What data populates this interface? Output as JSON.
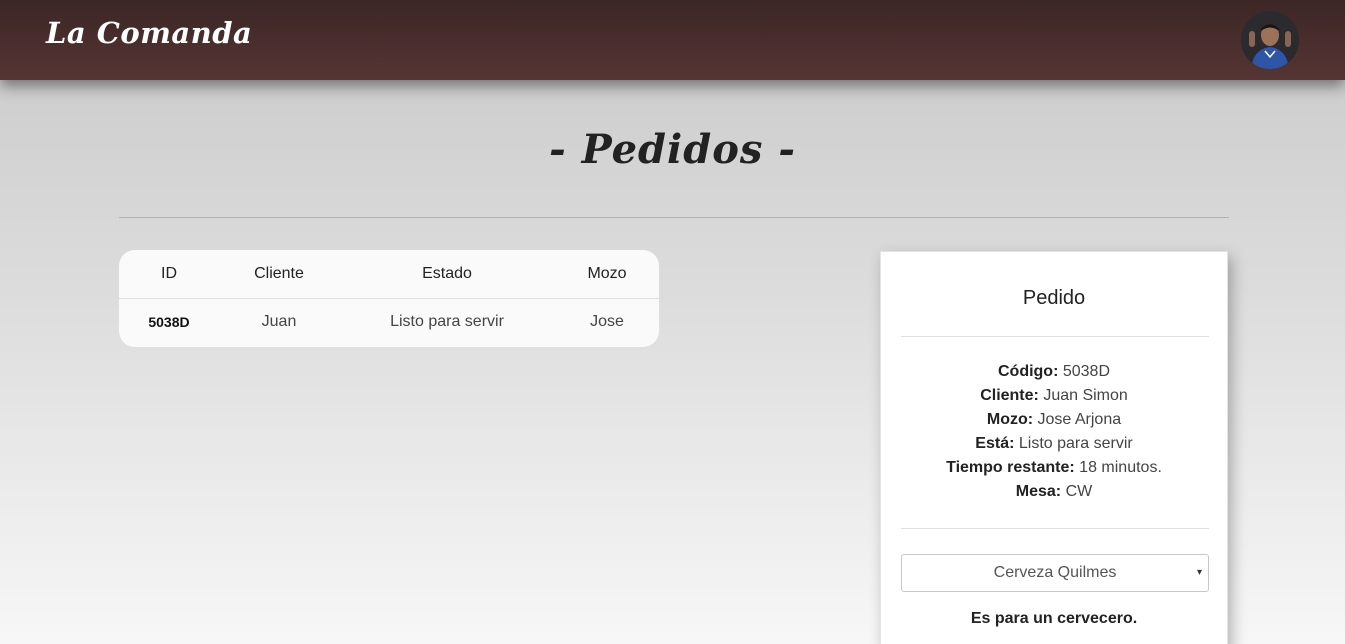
{
  "navbar": {
    "brand": "La Comanda",
    "avatar_icon": "user-avatar-photo"
  },
  "page": {
    "title": "- Pedidos -"
  },
  "orders_table": {
    "headers": [
      "ID",
      "Cliente",
      "Estado",
      "Mozo"
    ],
    "rows": [
      {
        "id": "5038D",
        "cliente": "Juan",
        "estado": "Listo para servir",
        "mozo": "Jose"
      }
    ]
  },
  "order_card": {
    "title": "Pedido",
    "fields": [
      {
        "label": "Código:",
        "value": "5038D"
      },
      {
        "label": "Cliente:",
        "value": "Juan Simon"
      },
      {
        "label": "Mozo:",
        "value": "Jose Arjona"
      },
      {
        "label": "Está:",
        "value": "Listo para servir"
      },
      {
        "label": "Tiempo restante:",
        "value": "18 minutos."
      },
      {
        "label": "Mesa:",
        "value": "CW"
      }
    ],
    "select": {
      "selected": "Cerveza Quilmes",
      "arrow": "▾"
    },
    "description": "Es para un cervecero."
  },
  "colors": {
    "navbar_top": "#3b2626",
    "navbar_bottom": "#553533",
    "background_top": "#c9c9c9",
    "background_bottom": "#f7f7f7"
  }
}
